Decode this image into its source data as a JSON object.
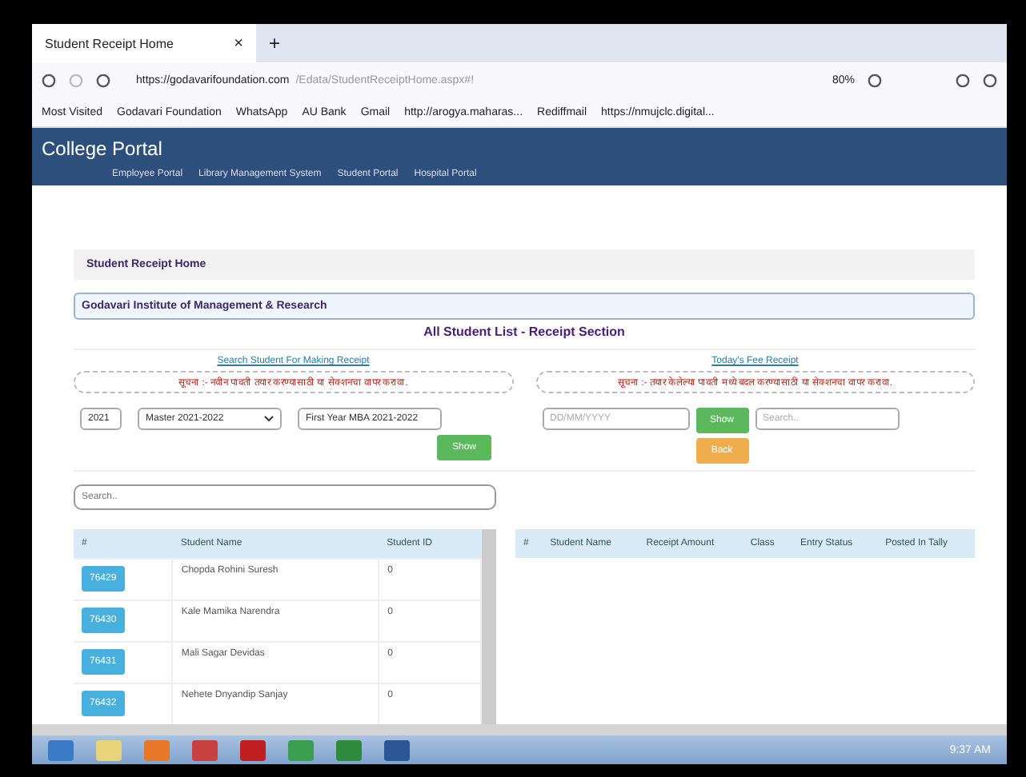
{
  "browser": {
    "tab_title": "Student Receipt Home",
    "tab_close": "×",
    "new_tab": "+",
    "url_host": "https://godavarifoundation.com",
    "url_path": "/Edata/StudentReceiptHome.aspx#!",
    "zoom": "80%",
    "bookmarks": [
      "Most Visited",
      "Godavari Foundation",
      "WhatsApp",
      "AU Bank",
      "Gmail",
      "http://arogya.maharas...",
      "Rediffmail",
      "https://nmujclc.digital..."
    ]
  },
  "header": {
    "title": "College Portal",
    "nav": [
      "Employee Portal",
      "Library Management System",
      "Student Portal",
      "Hospital Portal"
    ]
  },
  "breadcrumb": "Student Receipt Home",
  "institute": "Godavari Institute of Management & Research",
  "section_title": "All Student List - Receipt Section",
  "left": {
    "link": "Search Student For Making Receipt",
    "notice": "सूचना :- नवीन पावती तयार करण्यासाठी या सेक्शनचा वापर करावा.",
    "year": "2021",
    "course": "Master 2021-2022",
    "class": "First Year MBA 2021-2022",
    "show": "Show",
    "search_placeholder": "Search..",
    "columns": [
      "#",
      "Student Name",
      "Student ID"
    ],
    "rows": [
      {
        "no": "76429",
        "name": "Chopda Rohini Suresh",
        "id": "0"
      },
      {
        "no": "76430",
        "name": "Kale Mamika Narendra",
        "id": "0"
      },
      {
        "no": "76431",
        "name": "Mali Sagar Devidas",
        "id": "0"
      },
      {
        "no": "76432",
        "name": "Nehete Dnyandip Sanjay",
        "id": "0"
      }
    ]
  },
  "right": {
    "link": "Today's Fee Receipt",
    "notice": "सूचना :- तयार केलेल्या पावती मध्ये बदल करण्यासाठी या सेक्शनचा वापर करावा.",
    "date_placeholder": "DD/MM/YYYY",
    "show": "Show",
    "search_placeholder": "Search..",
    "back": "Back",
    "columns": [
      "#",
      "Student Name",
      "Receipt Amount",
      "Class",
      "Entry Status",
      "Posted In Tally"
    ]
  },
  "taskbar": {
    "time": "9:37 AM"
  }
}
